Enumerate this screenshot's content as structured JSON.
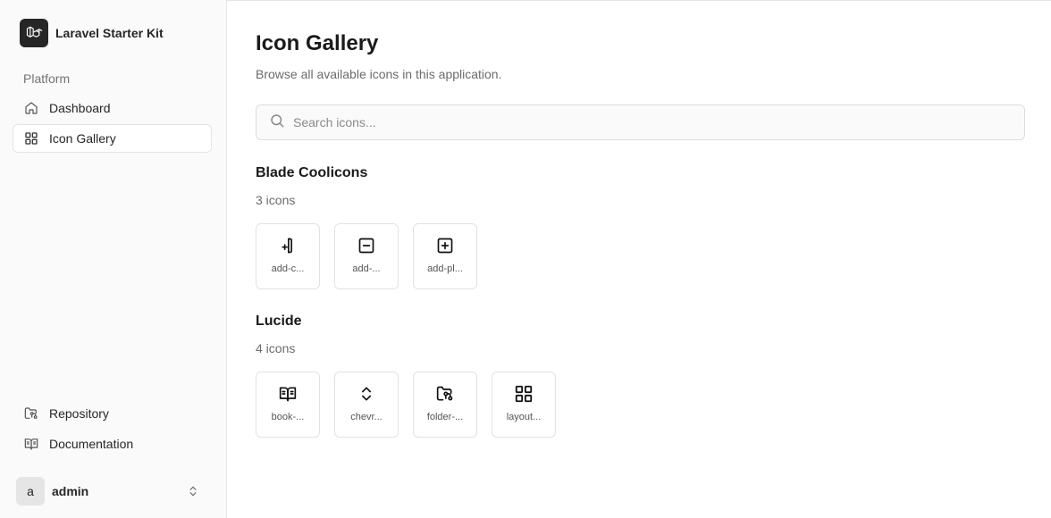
{
  "sidebar": {
    "app_name": "Laravel Starter Kit",
    "group_label": "Platform",
    "nav": [
      {
        "label": "Dashboard",
        "icon": "home-icon"
      },
      {
        "label": "Icon Gallery",
        "icon": "layout-grid-icon",
        "active": true
      }
    ],
    "footer_links": [
      {
        "label": "Repository",
        "icon": "folder-git-icon"
      },
      {
        "label": "Documentation",
        "icon": "book-open-icon"
      }
    ],
    "user": {
      "initial": "a",
      "name": "admin"
    }
  },
  "main": {
    "title": "Icon Gallery",
    "subtitle": "Browse all available icons in this application.",
    "search": {
      "placeholder": "Search icons...",
      "value": ""
    },
    "sets": [
      {
        "title": "Blade Coolicons",
        "count": "3 icons",
        "icons": [
          {
            "label": "add-c...",
            "icon": "add-column-icon"
          },
          {
            "label": "add-...",
            "icon": "minus-square-icon"
          },
          {
            "label": "add-pl...",
            "icon": "plus-square-icon"
          }
        ]
      },
      {
        "title": "Lucide",
        "count": "4 icons",
        "icons": [
          {
            "label": "book-...",
            "icon": "book-open-icon"
          },
          {
            "label": "chevr...",
            "icon": "chevrons-up-down-icon"
          },
          {
            "label": "folder-...",
            "icon": "folder-git-icon"
          },
          {
            "label": "layout...",
            "icon": "layout-grid-icon"
          }
        ]
      }
    ]
  },
  "colors": {
    "accent": "#262626",
    "muted": "#737373",
    "border": "#e5e5e5"
  }
}
